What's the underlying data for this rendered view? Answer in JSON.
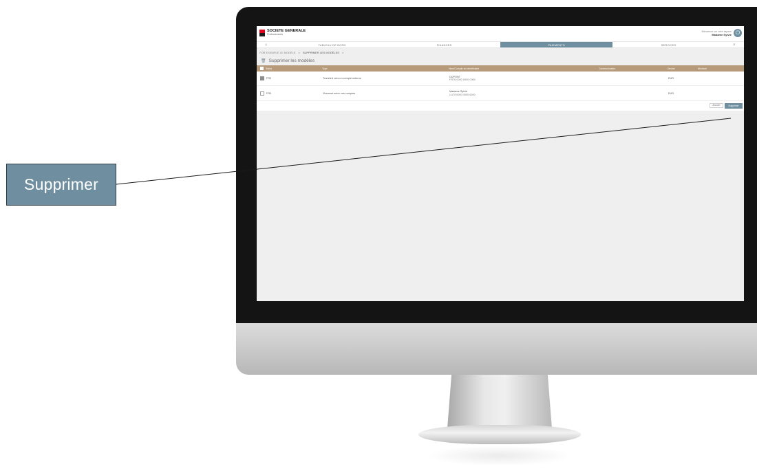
{
  "callout": {
    "label": "Supprimer"
  },
  "app": {
    "brand": {
      "name": "SOCIETE GENERALE",
      "sub": "Professionnels"
    },
    "user": {
      "greeting": "Bienvenue sur votre espace",
      "name": "Madame Sylvie"
    },
    "nav": {
      "home_icon": "house-icon",
      "tabs": [
        "TABLEAU DE BORD",
        "FINANCES",
        "PAIEMENTS",
        "SERVICES"
      ],
      "active_tab": "PAIEMENTS"
    },
    "breadcrumb": {
      "items": [
        "FOR EXEMPLE LE MODÈLE",
        "SUPPRIMER LES MODÈLES"
      ],
      "separator": ">"
    },
    "section": {
      "icon": "trash-icon",
      "title": "Supprimer les modèles"
    },
    "table": {
      "headers": [
        "Statut",
        "Type",
        "Nom/Compte du bénéficiaire",
        "Communication",
        "Devise",
        "Montant"
      ],
      "rows": [
        {
          "checked": true,
          "status": "FR0",
          "type": "Transfert vers un compte externe",
          "beneficiary_name": "DUPONT",
          "beneficiary_account": "FR76 0000 0000 0000",
          "communication": "",
          "currency": "EUR",
          "amount": ""
        },
        {
          "checked": false,
          "status": "FR0",
          "type": "Virement entre vos comptes",
          "beneficiary_name": "Madame Sylvie",
          "beneficiary_account": "LU70 0000 0000 0000",
          "communication": "",
          "currency": "EUR",
          "amount": ""
        }
      ]
    },
    "actions": {
      "cancel": "Annuler",
      "delete": "Supprimer"
    }
  },
  "colors": {
    "accent": "#6f8fa0",
    "table_header": "#b69a79",
    "brand_red": "#e2001a"
  }
}
